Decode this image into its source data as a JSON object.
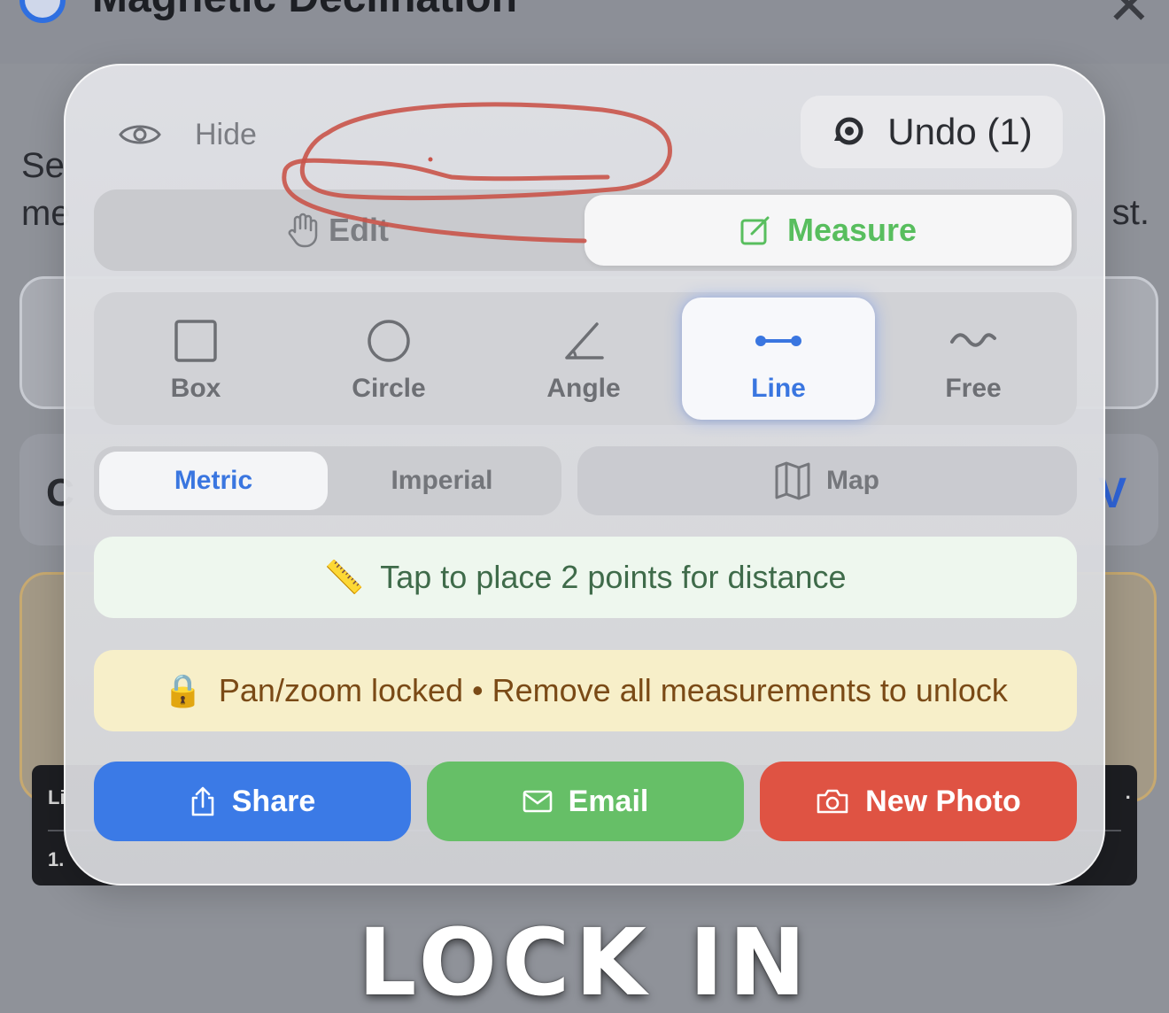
{
  "background": {
    "title": "Magnetic Declination",
    "desc_fragment_1": "Se",
    "desc_fragment_2": "me",
    "desc_fragment_right": "st.",
    "card_left_fragment": "C",
    "card_right_fragment": "V",
    "dark_text_1": "Li",
    "dark_text_2": "1.",
    "dark_dot": "·"
  },
  "panel": {
    "hide_label": "Hide",
    "undo_label": "Undo (1)",
    "modes": {
      "edit": "Edit",
      "measure": "Measure",
      "selected": "Measure"
    },
    "tools": [
      {
        "id": "box",
        "label": "Box",
        "icon": "square-icon"
      },
      {
        "id": "circle",
        "label": "Circle",
        "icon": "circle-icon"
      },
      {
        "id": "angle",
        "label": "Angle",
        "icon": "angle-icon"
      },
      {
        "id": "line",
        "label": "Line",
        "icon": "line-icon",
        "active": true
      },
      {
        "id": "free",
        "label": "Free",
        "icon": "squiggle-icon"
      }
    ],
    "units": {
      "metric": "Metric",
      "imperial": "Imperial",
      "selected": "Metric"
    },
    "map_label": "Map",
    "hint": {
      "emoji": "📏",
      "text": "Tap to place 2 points for distance"
    },
    "lock": {
      "emoji": "🔒",
      "text": "Pan/zoom locked • Remove all measurements to unlock"
    },
    "actions": {
      "share": "Share",
      "email": "Email",
      "new_photo": "New Photo"
    }
  },
  "caption": "LOCK IN",
  "colors": {
    "accent_blue": "#3b7ae6",
    "measure_green": "#58be5e",
    "email_green": "#66bf67",
    "photo_red": "#df5343",
    "scribble_red": "#c9544a"
  }
}
